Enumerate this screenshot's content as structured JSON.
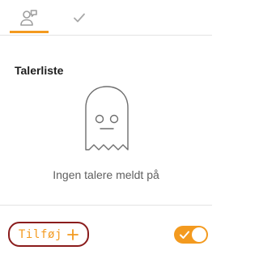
{
  "tabs": [
    {
      "icon": "speakers-icon",
      "active": true
    },
    {
      "icon": "check-icon",
      "active": false
    }
  ],
  "section": {
    "title": "Talerliste"
  },
  "empty_state": {
    "icon": "ghost-icon",
    "text": "Ingen talere meldt på"
  },
  "actions": {
    "add_label": "Tilføj",
    "add_icon": "plus-icon",
    "toggle_on": true
  },
  "colors": {
    "accent": "#f39a1f",
    "button_border": "#8a1c1c",
    "divider": "#e3e3e3",
    "icon_gray": "#9e9e9e"
  }
}
